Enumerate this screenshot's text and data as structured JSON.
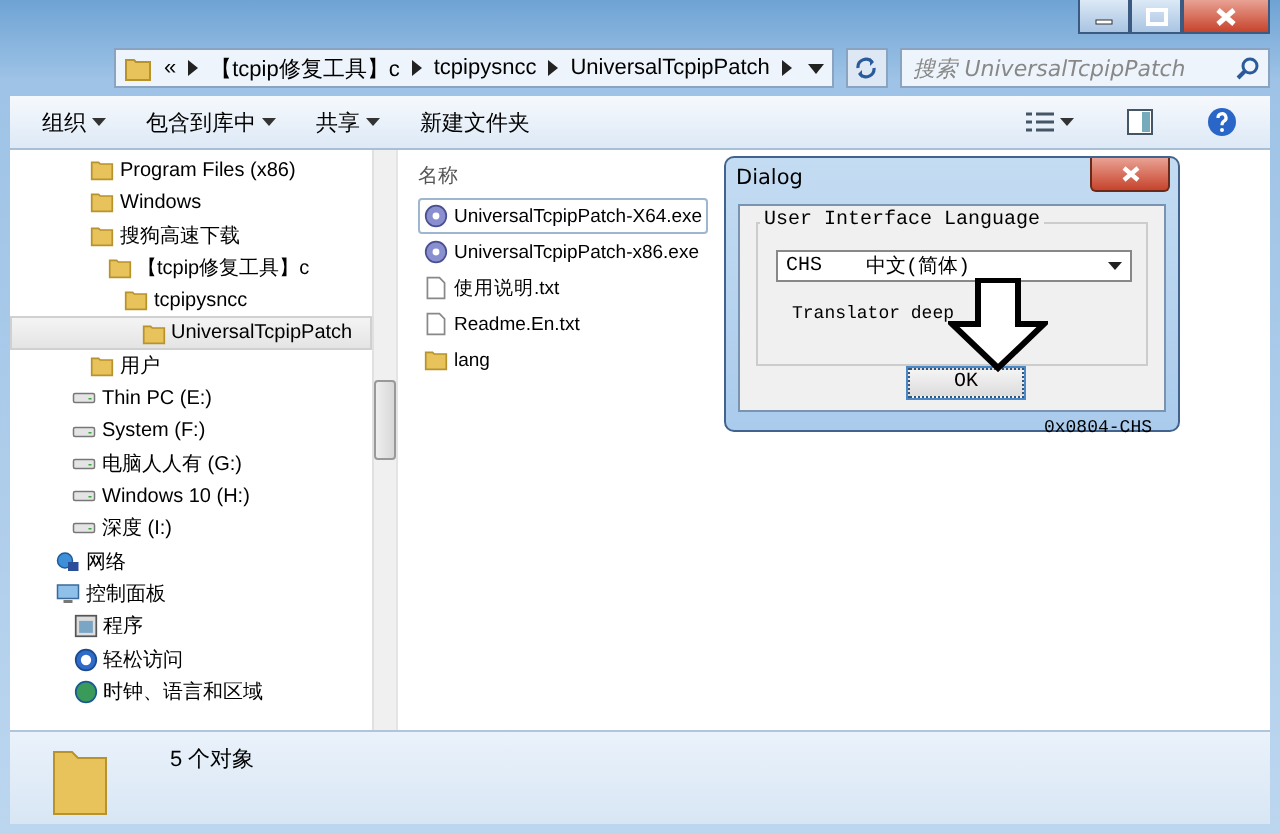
{
  "address_bar": {
    "crumbs": [
      "«",
      "【tcpip修复工具】c",
      "tcpipysncc",
      "UniversalTcpipPatch"
    ]
  },
  "search": {
    "placeholder": "搜索 UniversalTcpipPatch"
  },
  "toolbar": {
    "items": [
      {
        "label": "组织",
        "has_menu": true
      },
      {
        "label": "包含到库中",
        "has_menu": true
      },
      {
        "label": "共享",
        "has_menu": true
      },
      {
        "label": "新建文件夹",
        "has_menu": false
      }
    ]
  },
  "sidebar": {
    "folders": [
      {
        "label": "Program Files (x86)",
        "kind": "folder",
        "selected": false
      },
      {
        "label": "Windows",
        "kind": "folder",
        "selected": false
      },
      {
        "label": "搜狗高速下载",
        "kind": "folder",
        "selected": false,
        "children": [
          {
            "label": "【tcpip修复工具】c",
            "kind": "folder",
            "selected": false,
            "children": [
              {
                "label": "tcpipysncc",
                "kind": "folder",
                "selected": false,
                "children": [
                  {
                    "label": "UniversalTcpipPatch",
                    "kind": "folder",
                    "selected": true
                  }
                ]
              }
            ]
          }
        ]
      },
      {
        "label": "用户",
        "kind": "folder",
        "selected": false
      }
    ],
    "drives": [
      {
        "label": "Thin PC (E:)",
        "kind": "drive",
        "selected": false
      },
      {
        "label": "System (F:)",
        "kind": "drive",
        "selected": false
      },
      {
        "label": "电脑人人有 (G:)",
        "kind": "drive",
        "selected": false
      },
      {
        "label": "Windows 10 (H:)",
        "kind": "drive",
        "selected": false
      },
      {
        "label": "深度 (I:)",
        "kind": "drive",
        "selected": false
      }
    ],
    "places": [
      {
        "label": "网络",
        "kind": "network",
        "selected": false
      },
      {
        "label": "控制面板",
        "kind": "control_panel",
        "selected": false,
        "children": [
          {
            "label": "程序",
            "kind": "programs",
            "selected": false
          },
          {
            "label": "轻松访问",
            "kind": "access",
            "selected": false
          },
          {
            "label": "时钟、语言和区域",
            "kind": "clock",
            "selected": false
          }
        ]
      }
    ]
  },
  "file_list": {
    "column": "名称",
    "files": [
      {
        "name": "UniversalTcpipPatch-X64.exe",
        "kind": "exe",
        "selected": true
      },
      {
        "name": "UniversalTcpipPatch-x86.exe",
        "kind": "exe",
        "selected": false
      },
      {
        "name": "使用说明.txt",
        "kind": "txt",
        "selected": false
      },
      {
        "name": "Readme.En.txt",
        "kind": "txt",
        "selected": false
      },
      {
        "name": "lang",
        "kind": "folder",
        "selected": false
      }
    ]
  },
  "dialog": {
    "title": "Dialog",
    "group_label": "User Interface Language",
    "language_code": "CHS",
    "language_name": "中文(简体)",
    "translator": "Translator deep",
    "ok_button": "OK",
    "code": "0x0804-CHS"
  },
  "status_bar": {
    "text": "5 个对象"
  }
}
